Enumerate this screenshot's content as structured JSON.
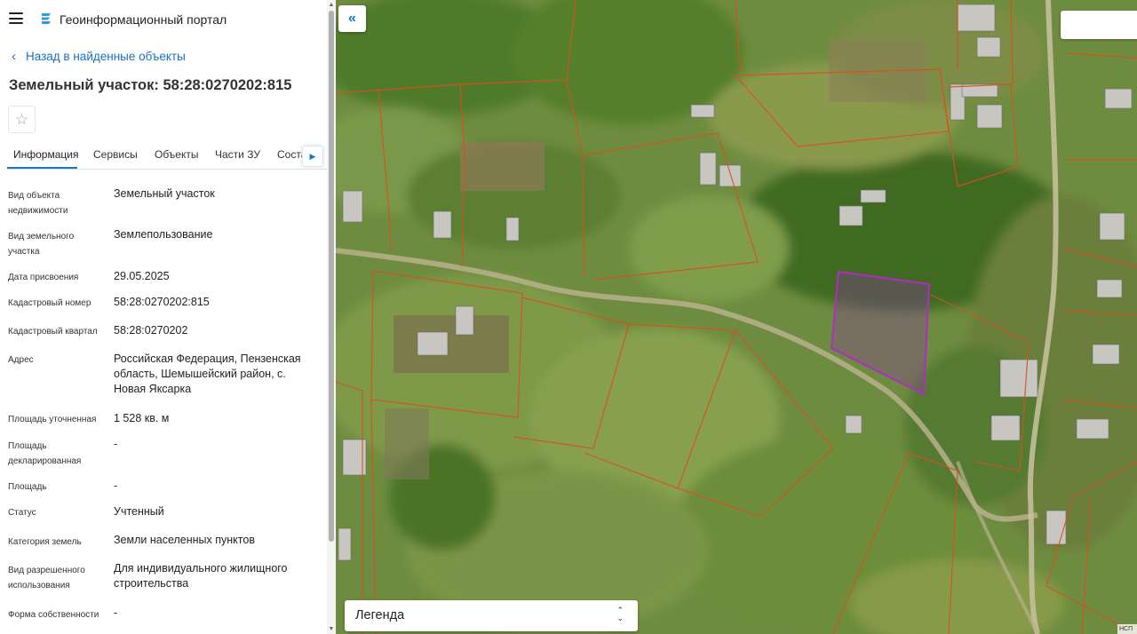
{
  "header": {
    "app_title": "Геоинформационный портал",
    "menu_icon": "hamburger-menu-icon",
    "logo_icon": "portal-logo-icon"
  },
  "navigation": {
    "back_label": "Назад в найденные объекты"
  },
  "object": {
    "title": "Земельный участок: 58:28:0270202:815"
  },
  "tabs": [
    {
      "label": "Информация",
      "active": true
    },
    {
      "label": "Сервисы",
      "active": false
    },
    {
      "label": "Объекты",
      "active": false
    },
    {
      "label": "Части ЗУ",
      "active": false
    },
    {
      "label": "Соста",
      "active": false
    }
  ],
  "properties": [
    {
      "label": "Вид объекта недвижимости",
      "value": "Земельный участок"
    },
    {
      "label": "Вид земельного участка",
      "value": "Землепользование"
    },
    {
      "label": "Дата присвоения",
      "value": "29.05.2025"
    },
    {
      "label": "Кадастровый номер",
      "value": "58:28:0270202:815"
    },
    {
      "label": "Кадастровый квартал",
      "value": "58:28:0270202"
    },
    {
      "label": "Адрес",
      "value": "Российская Федерация, Пензенская область, Шемышейский район, с. Новая Яксарка"
    },
    {
      "label": "Площадь уточненная",
      "value": "1 528 кв. м"
    },
    {
      "label": "Площадь декларированная",
      "value": "-"
    },
    {
      "label": "Площадь",
      "value": "-"
    },
    {
      "label": "Статус",
      "value": "Учтенный"
    },
    {
      "label": "Категория земель",
      "value": "Земли населенных пунктов"
    },
    {
      "label": "Вид разрешенного использования",
      "value": "Для индивидуального жилищного строительства"
    },
    {
      "label": "Форма собственности",
      "value": "-"
    }
  ],
  "map": {
    "legend_label": "Легенда",
    "attribution": "НСП",
    "boundary_color": "#d9501e",
    "selected_parcel_color": "#b02cc7"
  }
}
